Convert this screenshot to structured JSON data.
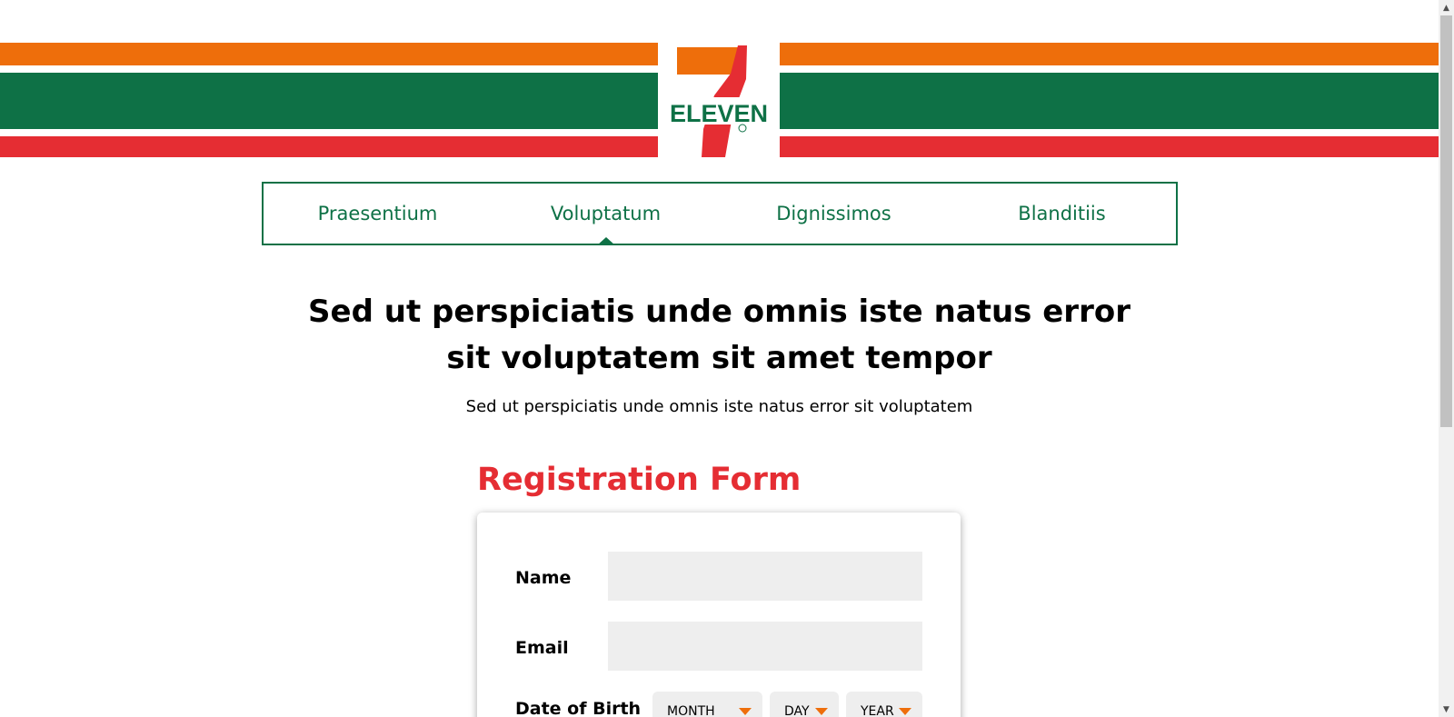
{
  "brand": {
    "logo_text": "ELEVEN",
    "colors": {
      "orange": "#ee6e0b",
      "green": "#0e7146",
      "red": "#e52d33"
    }
  },
  "nav": {
    "items": [
      {
        "label": "Praesentium",
        "active": false
      },
      {
        "label": "Voluptatum",
        "active": true
      },
      {
        "label": "Dignissimos",
        "active": false
      },
      {
        "label": "Blanditiis",
        "active": false
      }
    ]
  },
  "hero": {
    "headline": "Sed ut perspiciatis unde omnis iste natus error sit voluptatem sit amet tempor",
    "subline": "Sed ut perspiciatis unde omnis iste natus error sit voluptatem"
  },
  "form": {
    "title": "Registration Form",
    "name_label": "Name",
    "name_value": "",
    "email_label": "Email",
    "email_value": "",
    "dob_label": "Date of Birth",
    "month_value": "MONTH",
    "day_value": "DAY",
    "year_value": "YEAR"
  }
}
